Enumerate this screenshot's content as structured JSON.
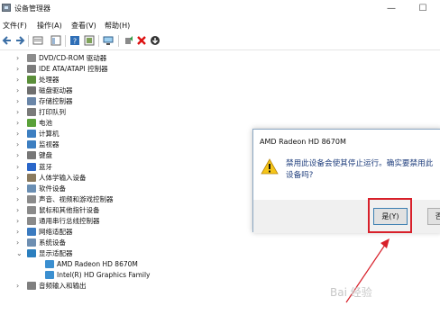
{
  "window": {
    "title": "设备管理器",
    "minimize_glyph": "—",
    "maximize_glyph": "☐"
  },
  "menu": [
    "文件(F)",
    "操作(A)",
    "查看(V)",
    "帮助(H)"
  ],
  "toolbar_icons": [
    "back-arrow-icon",
    "forward-arrow-icon",
    "properties-icon",
    "console-tree-icon",
    "help-icon",
    "driver-icon",
    "monitor-icon",
    "enable-device-icon",
    "uninstall-icon",
    "update-driver-icon"
  ],
  "tree": [
    {
      "label": "DVD/CD-ROM 驱动器",
      "icon": "dvd-drive-icon",
      "expanded": false
    },
    {
      "label": "IDE ATA/ATAPI 控制器",
      "icon": "ide-controller-icon",
      "expanded": false
    },
    {
      "label": "处理器",
      "icon": "processor-icon",
      "expanded": false
    },
    {
      "label": "磁盘驱动器",
      "icon": "disk-drive-icon",
      "expanded": false
    },
    {
      "label": "存储控制器",
      "icon": "storage-controller-icon",
      "expanded": false
    },
    {
      "label": "打印队列",
      "icon": "printer-icon",
      "expanded": false
    },
    {
      "label": "电池",
      "icon": "battery-icon",
      "expanded": false
    },
    {
      "label": "计算机",
      "icon": "computer-icon",
      "expanded": false
    },
    {
      "label": "监视器",
      "icon": "monitor-icon",
      "expanded": false
    },
    {
      "label": "键盘",
      "icon": "keyboard-icon",
      "expanded": false
    },
    {
      "label": "蓝牙",
      "icon": "bluetooth-icon",
      "expanded": false
    },
    {
      "label": "人体学输入设备",
      "icon": "hid-icon",
      "expanded": false
    },
    {
      "label": "软件设备",
      "icon": "software-device-icon",
      "expanded": false
    },
    {
      "label": "声音、视频和游戏控制器",
      "icon": "sound-icon",
      "expanded": false
    },
    {
      "label": "鼠标和其他指针设备",
      "icon": "mouse-icon",
      "expanded": false
    },
    {
      "label": "通用串行总线控制器",
      "icon": "usb-icon",
      "expanded": false
    },
    {
      "label": "网络适配器",
      "icon": "network-adapter-icon",
      "expanded": false
    },
    {
      "label": "系统设备",
      "icon": "system-device-icon",
      "expanded": false
    },
    {
      "label": "显示适配器",
      "icon": "display-adapter-icon",
      "expanded": true
    },
    {
      "label": "AMD Radeon HD 8670M",
      "icon": "display-device-icon",
      "child": true
    },
    {
      "label": "Intel(R) HD Graphics Family",
      "icon": "display-device-icon",
      "child": true
    },
    {
      "label": "音频输入和输出",
      "icon": "audio-io-icon",
      "expanded": false
    }
  ],
  "dialog": {
    "title": "AMD Radeon HD 8670M",
    "message": "禁用此设备会使其停止运行。确实要禁用此设备吗?",
    "yes_label": "是(Y)",
    "no_label": "否(N)"
  },
  "annotation": {
    "highlight_color": "#d8202a"
  },
  "watermark": "Bai 经验"
}
